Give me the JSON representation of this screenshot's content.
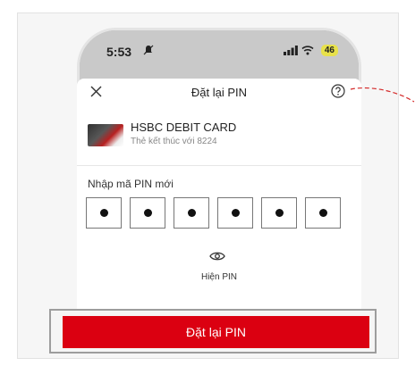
{
  "status_bar": {
    "time": "5:53",
    "battery": "46"
  },
  "sheet": {
    "title": "Đặt lại PIN"
  },
  "card": {
    "name": "HSBC DEBIT CARD",
    "subtitle": "Thẻ kết thúc với 8224"
  },
  "pin": {
    "label": "Nhập mã PIN mới",
    "digits": [
      "•",
      "•",
      "•",
      "•",
      "•",
      "•"
    ],
    "show_label": "Hiện PIN"
  },
  "actions": {
    "reset_label": "Đặt lại PIN"
  },
  "colors": {
    "primary": "#db0011",
    "annotation": "#d42a2a"
  }
}
